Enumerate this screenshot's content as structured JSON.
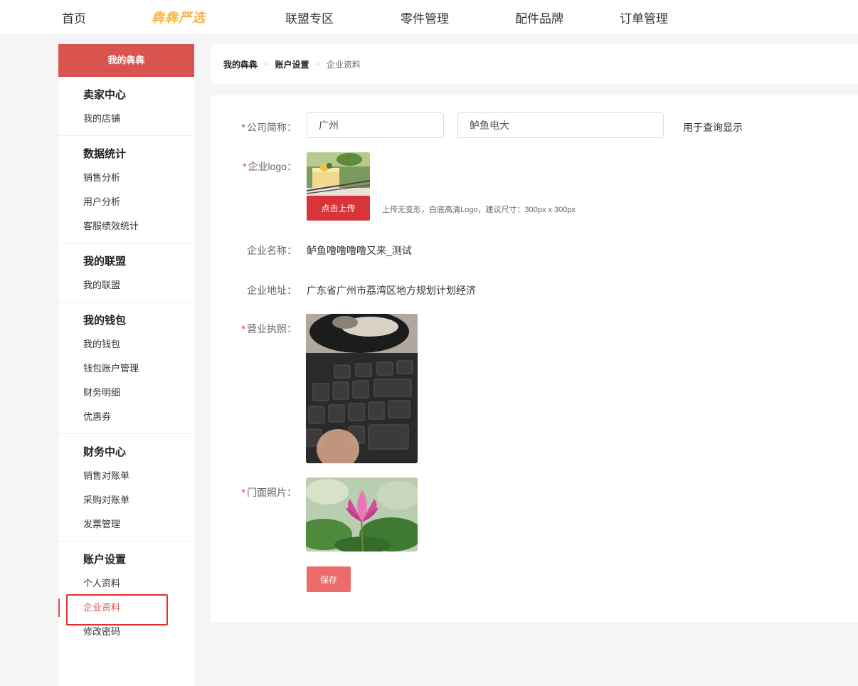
{
  "topnav": {
    "home": "首页",
    "brand": "犇犇严选",
    "links": [
      "联盟专区",
      "零件管理",
      "配件品牌",
      "订单管理"
    ]
  },
  "sidebar": {
    "header": "我的犇犇",
    "groups": [
      {
        "title": "卖家中心",
        "items": [
          "我的店铺"
        ]
      },
      {
        "title": "数据统计",
        "items": [
          "销售分析",
          "用户分析",
          "客服绩效统计"
        ]
      },
      {
        "title": "我的联盟",
        "items": [
          "我的联盟"
        ]
      },
      {
        "title": "我的钱包",
        "items": [
          "我的钱包",
          "钱包账户管理",
          "财务明细",
          "优惠券"
        ]
      },
      {
        "title": "财务中心",
        "items": [
          "销售对账单",
          "采购对账单",
          "发票管理"
        ]
      },
      {
        "title": "账户设置",
        "items": [
          "个人资料",
          "企业资料",
          "修改密码"
        ]
      }
    ],
    "active_item": "企业资料"
  },
  "breadcrumb": [
    "我的犇犇",
    "账户设置",
    "企业资料"
  ],
  "form": {
    "short_name": {
      "label": "公司简称：",
      "city_value": "广州",
      "name_value": "鲈鱼电大",
      "hint": "用于查询显示"
    },
    "logo": {
      "label": "企业logo：",
      "upload_label": "点击上传",
      "upload_hint": "上传无变形，白底高清Logo，建议尺寸：300px x 300px"
    },
    "company_name": {
      "label": "企业名称：",
      "value": "鲈鱼噜噜噜噜又来_测试"
    },
    "company_address": {
      "label": "企业地址：",
      "value": "广东省广州市荔湾区地方规划计划经济"
    },
    "business_license": {
      "label": "营业执照："
    },
    "storefront_photo": {
      "label": "门面照片："
    },
    "save_label": "保存"
  },
  "colors": {
    "accent": "#d9534f",
    "required": "#e0302e",
    "brand": "#f5b54a",
    "save": "#eb6b6b"
  }
}
